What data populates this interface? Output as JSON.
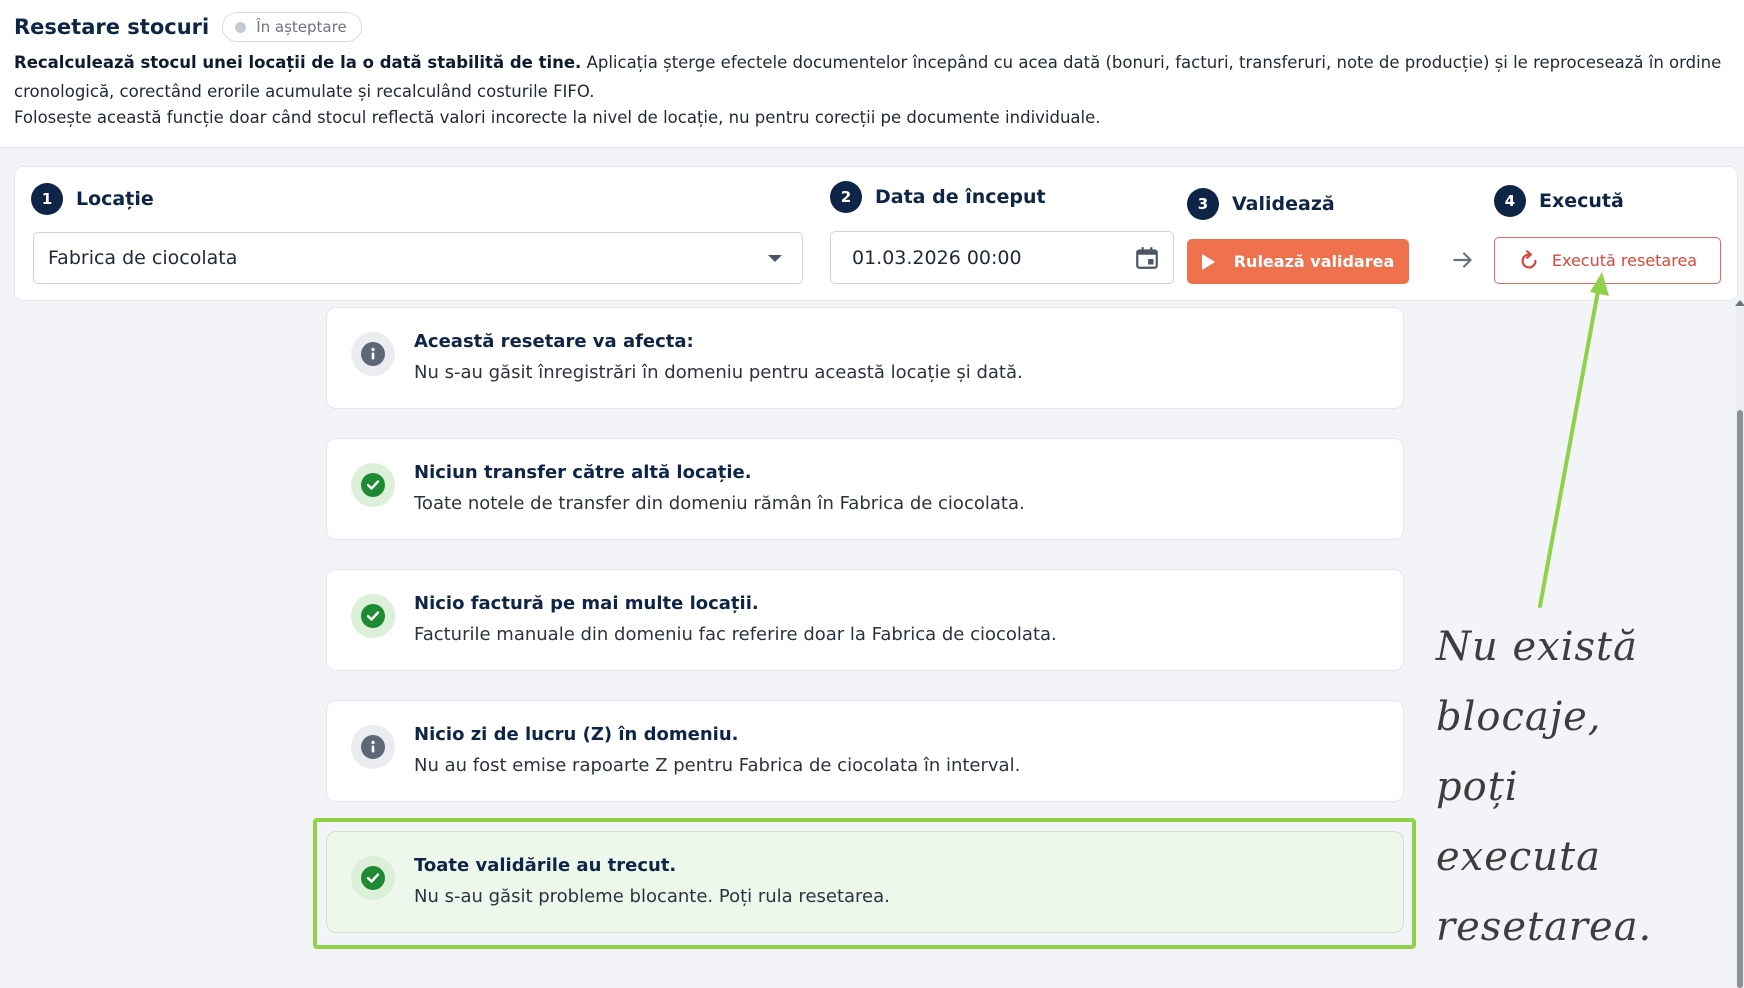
{
  "header": {
    "title": "Resetare stocuri",
    "status_badge": "În așteptare",
    "description_bold": "Recalculează stocul unei locații de la o dată stabilită de tine.",
    "description_rest": " Aplicația șterge efectele documentelor începând cu acea dată (bonuri, facturi, transferuri, note de producție) și le reprocesează în ordine cronologică, corectând erorile acumulate și recalculând costurile FIFO.",
    "description_line2": "Folosește această funcție doar când stocul reflectă valori incorecte la nivel de locație, nu pentru corecții pe documente individuale."
  },
  "steps": [
    {
      "number": "1",
      "label": "Locație"
    },
    {
      "number": "2",
      "label": "Data de început"
    },
    {
      "number": "3",
      "label": "Validează"
    },
    {
      "number": "4",
      "label": "Execută"
    }
  ],
  "location_select": {
    "value": "Fabrica de ciocolata"
  },
  "start_date": {
    "value": "01.03.2026 00:00"
  },
  "buttons": {
    "validate": "Rulează validarea",
    "execute": "Execută resetarea"
  },
  "results": [
    {
      "status": "info",
      "title": "Această resetare va afecta:",
      "text": "Nu s-au găsit înregistrări în domeniu pentru această locație și dată."
    },
    {
      "status": "ok",
      "title": "Niciun transfer către altă locație.",
      "text": "Toate notele de transfer din domeniu rămân în Fabrica de ciocolata."
    },
    {
      "status": "ok",
      "title": "Nicio factură pe mai multe locații.",
      "text": "Facturile manuale din domeniu fac referire doar la Fabrica de ciocolata."
    },
    {
      "status": "info",
      "title": "Nicio zi de lucru (Z) în domeniu.",
      "text": "Nu au fost emise rapoarte Z pentru Fabrica de ciocolata în interval."
    },
    {
      "status": "ok",
      "title": "Toate validările au trecut.",
      "text": "Nu s-au găsit probleme blocante. Poți rula resetarea."
    }
  ],
  "annotation": {
    "lines": [
      "Nu există",
      "blocaje,",
      "poți",
      "executa",
      "resetarea."
    ],
    "color": "#8fd24a"
  },
  "colors": {
    "primary": "#0f2547",
    "accent": "#f0714e",
    "danger": "#d9473a",
    "success": "#1f8a34",
    "highlight": "#8fd24a"
  }
}
